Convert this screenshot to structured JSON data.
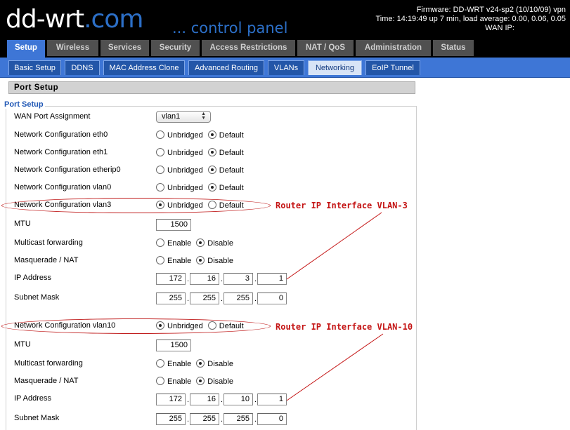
{
  "header": {
    "logo_main": "dd-wrt",
    "logo_domain": ".com",
    "subtitle": "... control panel",
    "firmware": "Firmware: DD-WRT v24-sp2 (10/10/09) vpn",
    "time": "Time: 14:19:49 up 7 min, load average: 0.00, 0.06, 0.05",
    "wan_ip_label": "WAN IP:"
  },
  "main_tabs": [
    "Setup",
    "Wireless",
    "Services",
    "Security",
    "Access Restrictions",
    "NAT / QoS",
    "Administration",
    "Status"
  ],
  "sub_tabs": [
    "Basic Setup",
    "DDNS",
    "MAC Address Clone",
    "Advanced Routing",
    "VLANs",
    "Networking",
    "EoIP Tunnel"
  ],
  "section_title": "Port Setup",
  "fieldset_legend": "Port Setup",
  "wan_port": {
    "label": "WAN Port Assignment",
    "value": "vlan1"
  },
  "radio_labels": {
    "unbridged": "Unbridged",
    "default": "Default",
    "enable": "Enable",
    "disable": "Disable"
  },
  "net_configs": [
    {
      "label": "Network Configuration eth0",
      "selected": "Default"
    },
    {
      "label": "Network Configuration eth1",
      "selected": "Default"
    },
    {
      "label": "Network Configuration etherip0",
      "selected": "Default"
    },
    {
      "label": "Network Configuration vlan0",
      "selected": "Default"
    }
  ],
  "vlan3": {
    "config_label": "Network Configuration vlan3",
    "selected": "Unbridged",
    "mtu_label": "MTU",
    "mtu": "1500",
    "multicast_label": "Multicast forwarding",
    "multicast": "Disable",
    "nat_label": "Masquerade / NAT",
    "nat": "Disable",
    "ip_label": "IP Address",
    "ip": [
      "172",
      "16",
      "3",
      "1"
    ],
    "mask_label": "Subnet Mask",
    "mask": [
      "255",
      "255",
      "255",
      "0"
    ]
  },
  "vlan10": {
    "config_label": "Network Configuration vlan10",
    "selected": "Unbridged",
    "mtu_label": "MTU",
    "mtu": "1500",
    "multicast_label": "Multicast forwarding",
    "multicast": "Disable",
    "nat_label": "Masquerade / NAT",
    "nat": "Disable",
    "ip_label": "IP Address",
    "ip": [
      "172",
      "16",
      "10",
      "1"
    ],
    "mask_label": "Subnet Mask",
    "mask": [
      "255",
      "255",
      "255",
      "0"
    ]
  },
  "annotations": {
    "vlan3": "Router IP Interface VLAN-3",
    "vlan10": "Router IP Interface VLAN-10"
  },
  "colors": {
    "accent": "#3e76d6",
    "annotation": "#c41414",
    "legend": "#1f57b5"
  }
}
